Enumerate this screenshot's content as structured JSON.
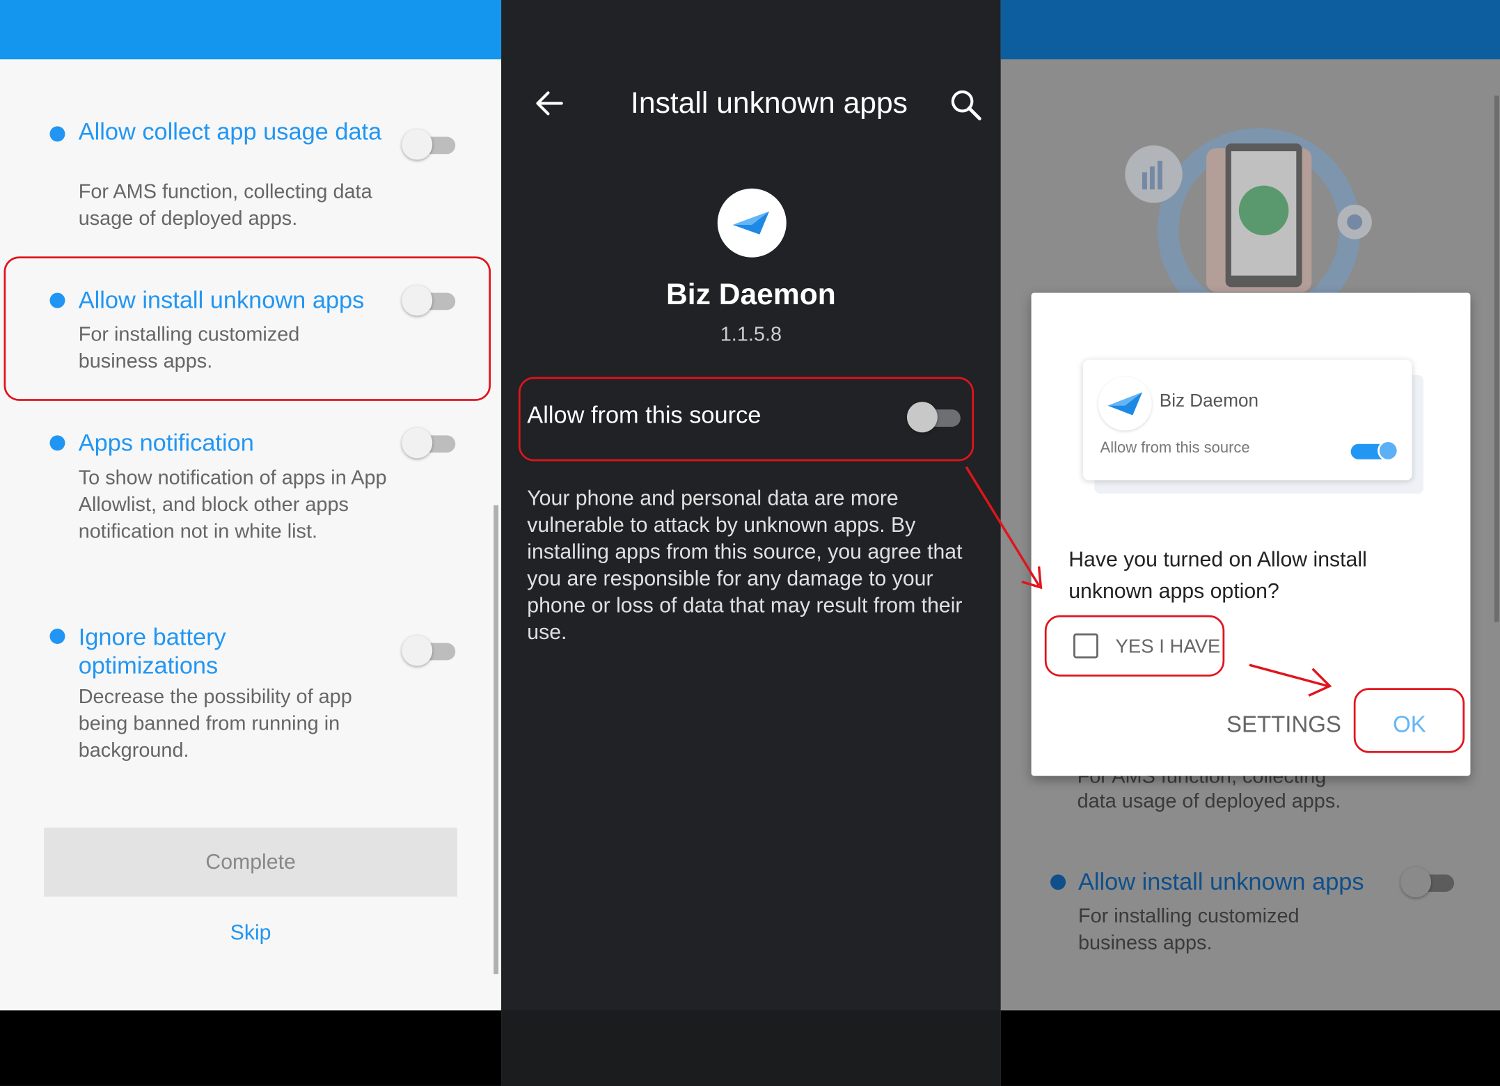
{
  "panel1": {
    "items": [
      {
        "title": "Allow collect app usage data",
        "desc": "For AMS function, collecting data usage of deployed apps."
      },
      {
        "title": "Allow install unknown apps",
        "desc": "For installing customized business apps."
      },
      {
        "title": "Apps notification",
        "desc": "To show notification of apps in App Allowlist, and block other apps notification not in white list."
      },
      {
        "title": "Ignore battery optimizations",
        "desc": "Decrease the possibility of app being banned from running in background."
      }
    ],
    "complete_label": "Complete",
    "skip_label": "Skip"
  },
  "panel2": {
    "title": "Install unknown apps",
    "app_name": "Biz Daemon",
    "app_version": "1.1.5.8",
    "allow_label": "Allow from this source",
    "warning": "Your phone and personal data are more vulnerable to attack by unknown apps. By installing apps from this source, you agree that you are responsible for any damage to your phone or loss of data that may result from their use."
  },
  "panel3": {
    "dialog": {
      "card_app_name": "Biz Daemon",
      "card_allow_label": "Allow from this source",
      "question": "Have you turned on Allow install unknown apps option?",
      "checkbox_label": "YES I HAVE",
      "settings_label": "SETTINGS",
      "ok_label": "OK"
    },
    "behind_desc1_partial": "For AMS function, collecting",
    "behind_desc1_end": "data usage of deployed apps.",
    "behind_item_title": "Allow install unknown apps",
    "behind_item_desc": "For installing customized business apps."
  },
  "colors": {
    "accent": "#2196f3",
    "highlight": "#e0141c",
    "dark_bg": "#202225"
  }
}
